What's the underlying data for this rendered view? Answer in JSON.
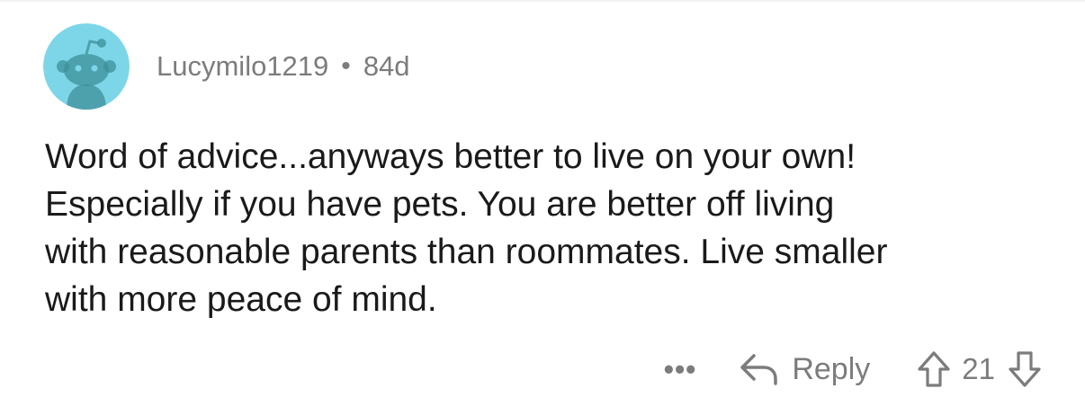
{
  "comment": {
    "username": "Lucymilo1219",
    "separator": "•",
    "age": "84d",
    "body_lines": [
      "Word of advice...anyways better to live on your own!",
      "Especially if you have pets. You are better off living",
      "with reasonable parents than roommates. Live smaller",
      "with more peace of mind."
    ],
    "avatar_icon": "snoo-avatar-icon",
    "avatar_color": "#7dd6e8"
  },
  "actions": {
    "more_label": "•••",
    "more_icon": "more-dots-icon",
    "reply_label": "Reply",
    "reply_icon": "reply-arrow-icon",
    "upvote_icon": "upvote-arrow-icon",
    "vote_count": "21",
    "downvote_icon": "downvote-arrow-icon"
  },
  "colors": {
    "muted_text": "#7c7c7c",
    "body_text": "#1a1a1b",
    "background": "#ffffff"
  }
}
